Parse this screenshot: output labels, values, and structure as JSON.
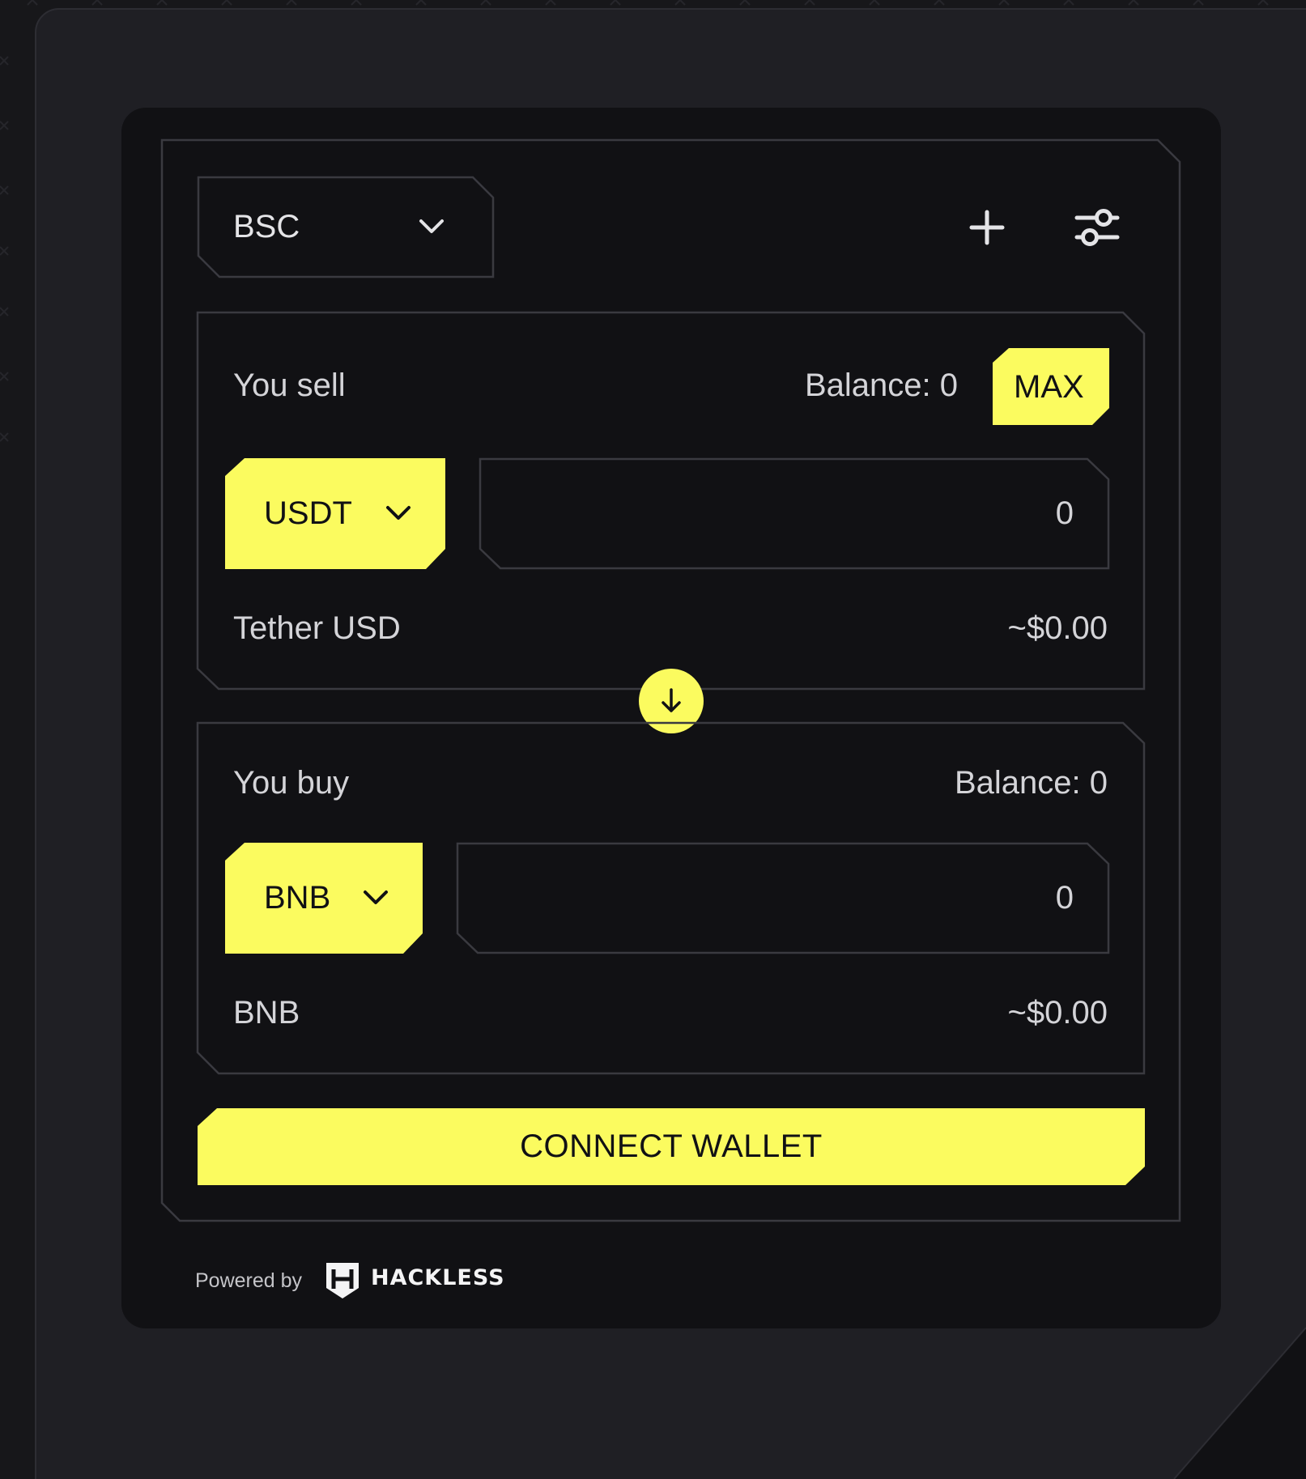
{
  "network": {
    "selected": "BSC",
    "chevron_icon": "chevron-down-icon"
  },
  "toolbar": {
    "add_icon": "plus-icon",
    "settings_icon": "sliders-icon"
  },
  "sell": {
    "label": "You sell",
    "balance": "Balance: 0",
    "max_label": "MAX",
    "token_symbol": "USDT",
    "token_name": "Tether USD",
    "amount": "0",
    "usd_value": "~$0.00"
  },
  "swap": {
    "icon": "arrow-down-icon"
  },
  "buy": {
    "label": "You buy",
    "balance": "Balance: 0",
    "token_symbol": "BNB",
    "token_name": "BNB",
    "amount": "0",
    "usd_value": "~$0.00"
  },
  "actions": {
    "connect_label": "CONNECT WALLET"
  },
  "footer": {
    "powered_by": "Powered by",
    "brand": "HACKLESS"
  },
  "colors": {
    "accent": "#fbfb5f",
    "background": "#17171a",
    "panel": "#111114",
    "border": "#3a3a40"
  }
}
